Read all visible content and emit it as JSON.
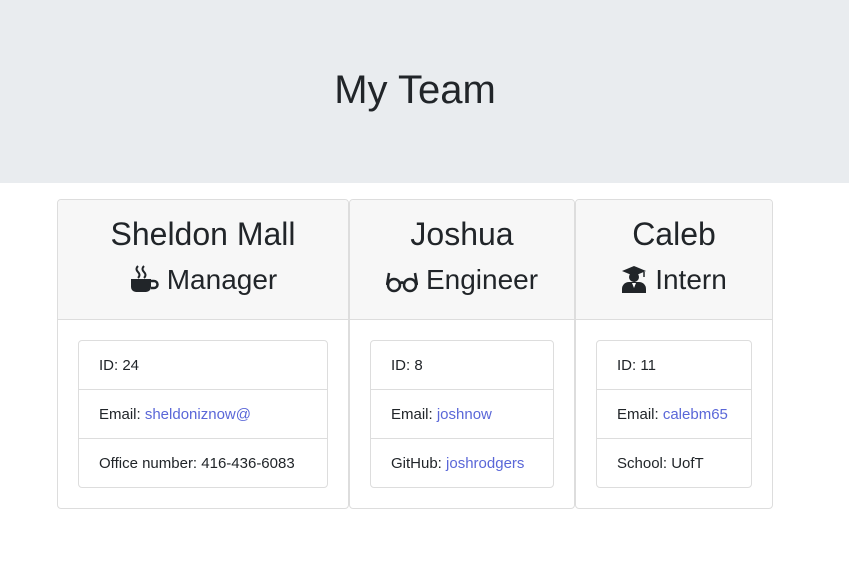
{
  "header": {
    "title": "My Team"
  },
  "employees": [
    {
      "name": "Sheldon Mall",
      "role": "Manager",
      "role_icon": "coffee-mug-icon",
      "id_label": "ID: 24",
      "email_label": "Email: ",
      "email": "sheldoniznow@",
      "extra_label": "Office number: 416-436-6083"
    },
    {
      "name": "Joshua",
      "role": "Engineer",
      "role_icon": "glasses-icon",
      "id_label": "ID: 8",
      "email_label": "Email: ",
      "email": "joshnow",
      "extra_prefix": "GitHub: ",
      "github": "joshrodgers"
    },
    {
      "name": "Caleb",
      "role": "Intern",
      "role_icon": "graduate-icon",
      "id_label": "ID: 11",
      "email_label": "Email: ",
      "email": "calebm65",
      "extra_label": "School: UofT"
    }
  ],
  "colors": {
    "link": "#5a67d8",
    "header_bg": "#e9ecef",
    "card_header_bg": "#f7f7f7"
  }
}
